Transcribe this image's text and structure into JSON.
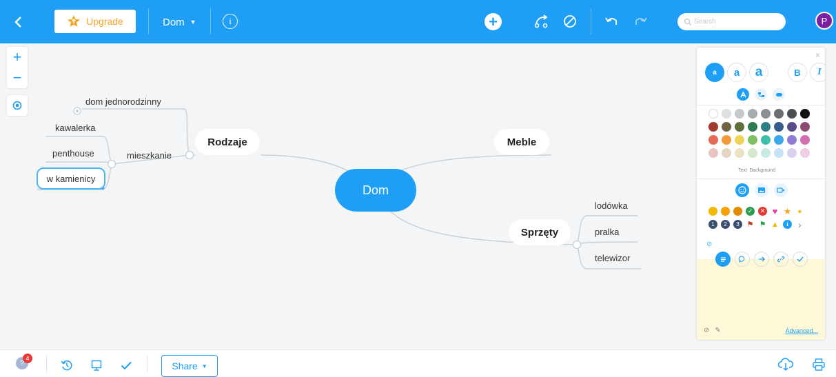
{
  "topbar": {
    "upgrade_label": "Upgrade",
    "map_title": "Dom",
    "info_glyph": "i",
    "add_glyph": "+",
    "search_placeholder": "Search",
    "avatar_initial": "P",
    "accent_color": "#1e9ef4"
  },
  "zoom": {
    "in_glyph": "+",
    "out_glyph": "−"
  },
  "map": {
    "root": "Dom",
    "nodes": {
      "rodzaje": "Rodzaje",
      "meble": "Meble",
      "sprzety": "Sprzęty",
      "dom_jednorodzinny": "dom jednorodzinny",
      "mieszkanie": "mieszkanie",
      "kawalerka": "kawalerka",
      "penthouse": "penthouse",
      "w_kamienicy": "w kamienicy",
      "lodowka": "lodówka",
      "pralka": "pralka",
      "telewizor": "telewizor"
    }
  },
  "panel": {
    "close_glyph": "×",
    "text_size_small": "a",
    "text_size_medium": "a",
    "text_size_large": "a",
    "bold_glyph": "B",
    "italic_glyph": "I",
    "text_label": "Text",
    "background_label": "Background",
    "advanced_label": "Advanced...",
    "more_icons_glyph": "›",
    "icon_numbers": [
      "1",
      "2",
      "3"
    ],
    "info_glyph": "i",
    "colors": [
      "#ffffff",
      "#dde0e2",
      "#c4c9cc",
      "#a6abae",
      "#8a8f92",
      "#6a6f72",
      "#4a4f52",
      "#111111",
      "#a23b2f",
      "#6e6445",
      "#5d6e3b",
      "#2e7d4f",
      "#2e7f87",
      "#365d8f",
      "#5a4a8c",
      "#8d4b6f",
      "#e56b58",
      "#f29b38",
      "#f0d35b",
      "#7fc05c",
      "#3fbfa8",
      "#3aa8ea",
      "#8f7ad6",
      "#d26fb0",
      "#e9c5c0",
      "#e5d4c4",
      "#e9e3c3",
      "#d7e7cd",
      "#c9e9e5",
      "#c7e3f5",
      "#d9d0ef",
      "#efcde5"
    ]
  },
  "bottombar": {
    "help_glyph": "?",
    "notification_count": "4",
    "share_label": "Share"
  }
}
